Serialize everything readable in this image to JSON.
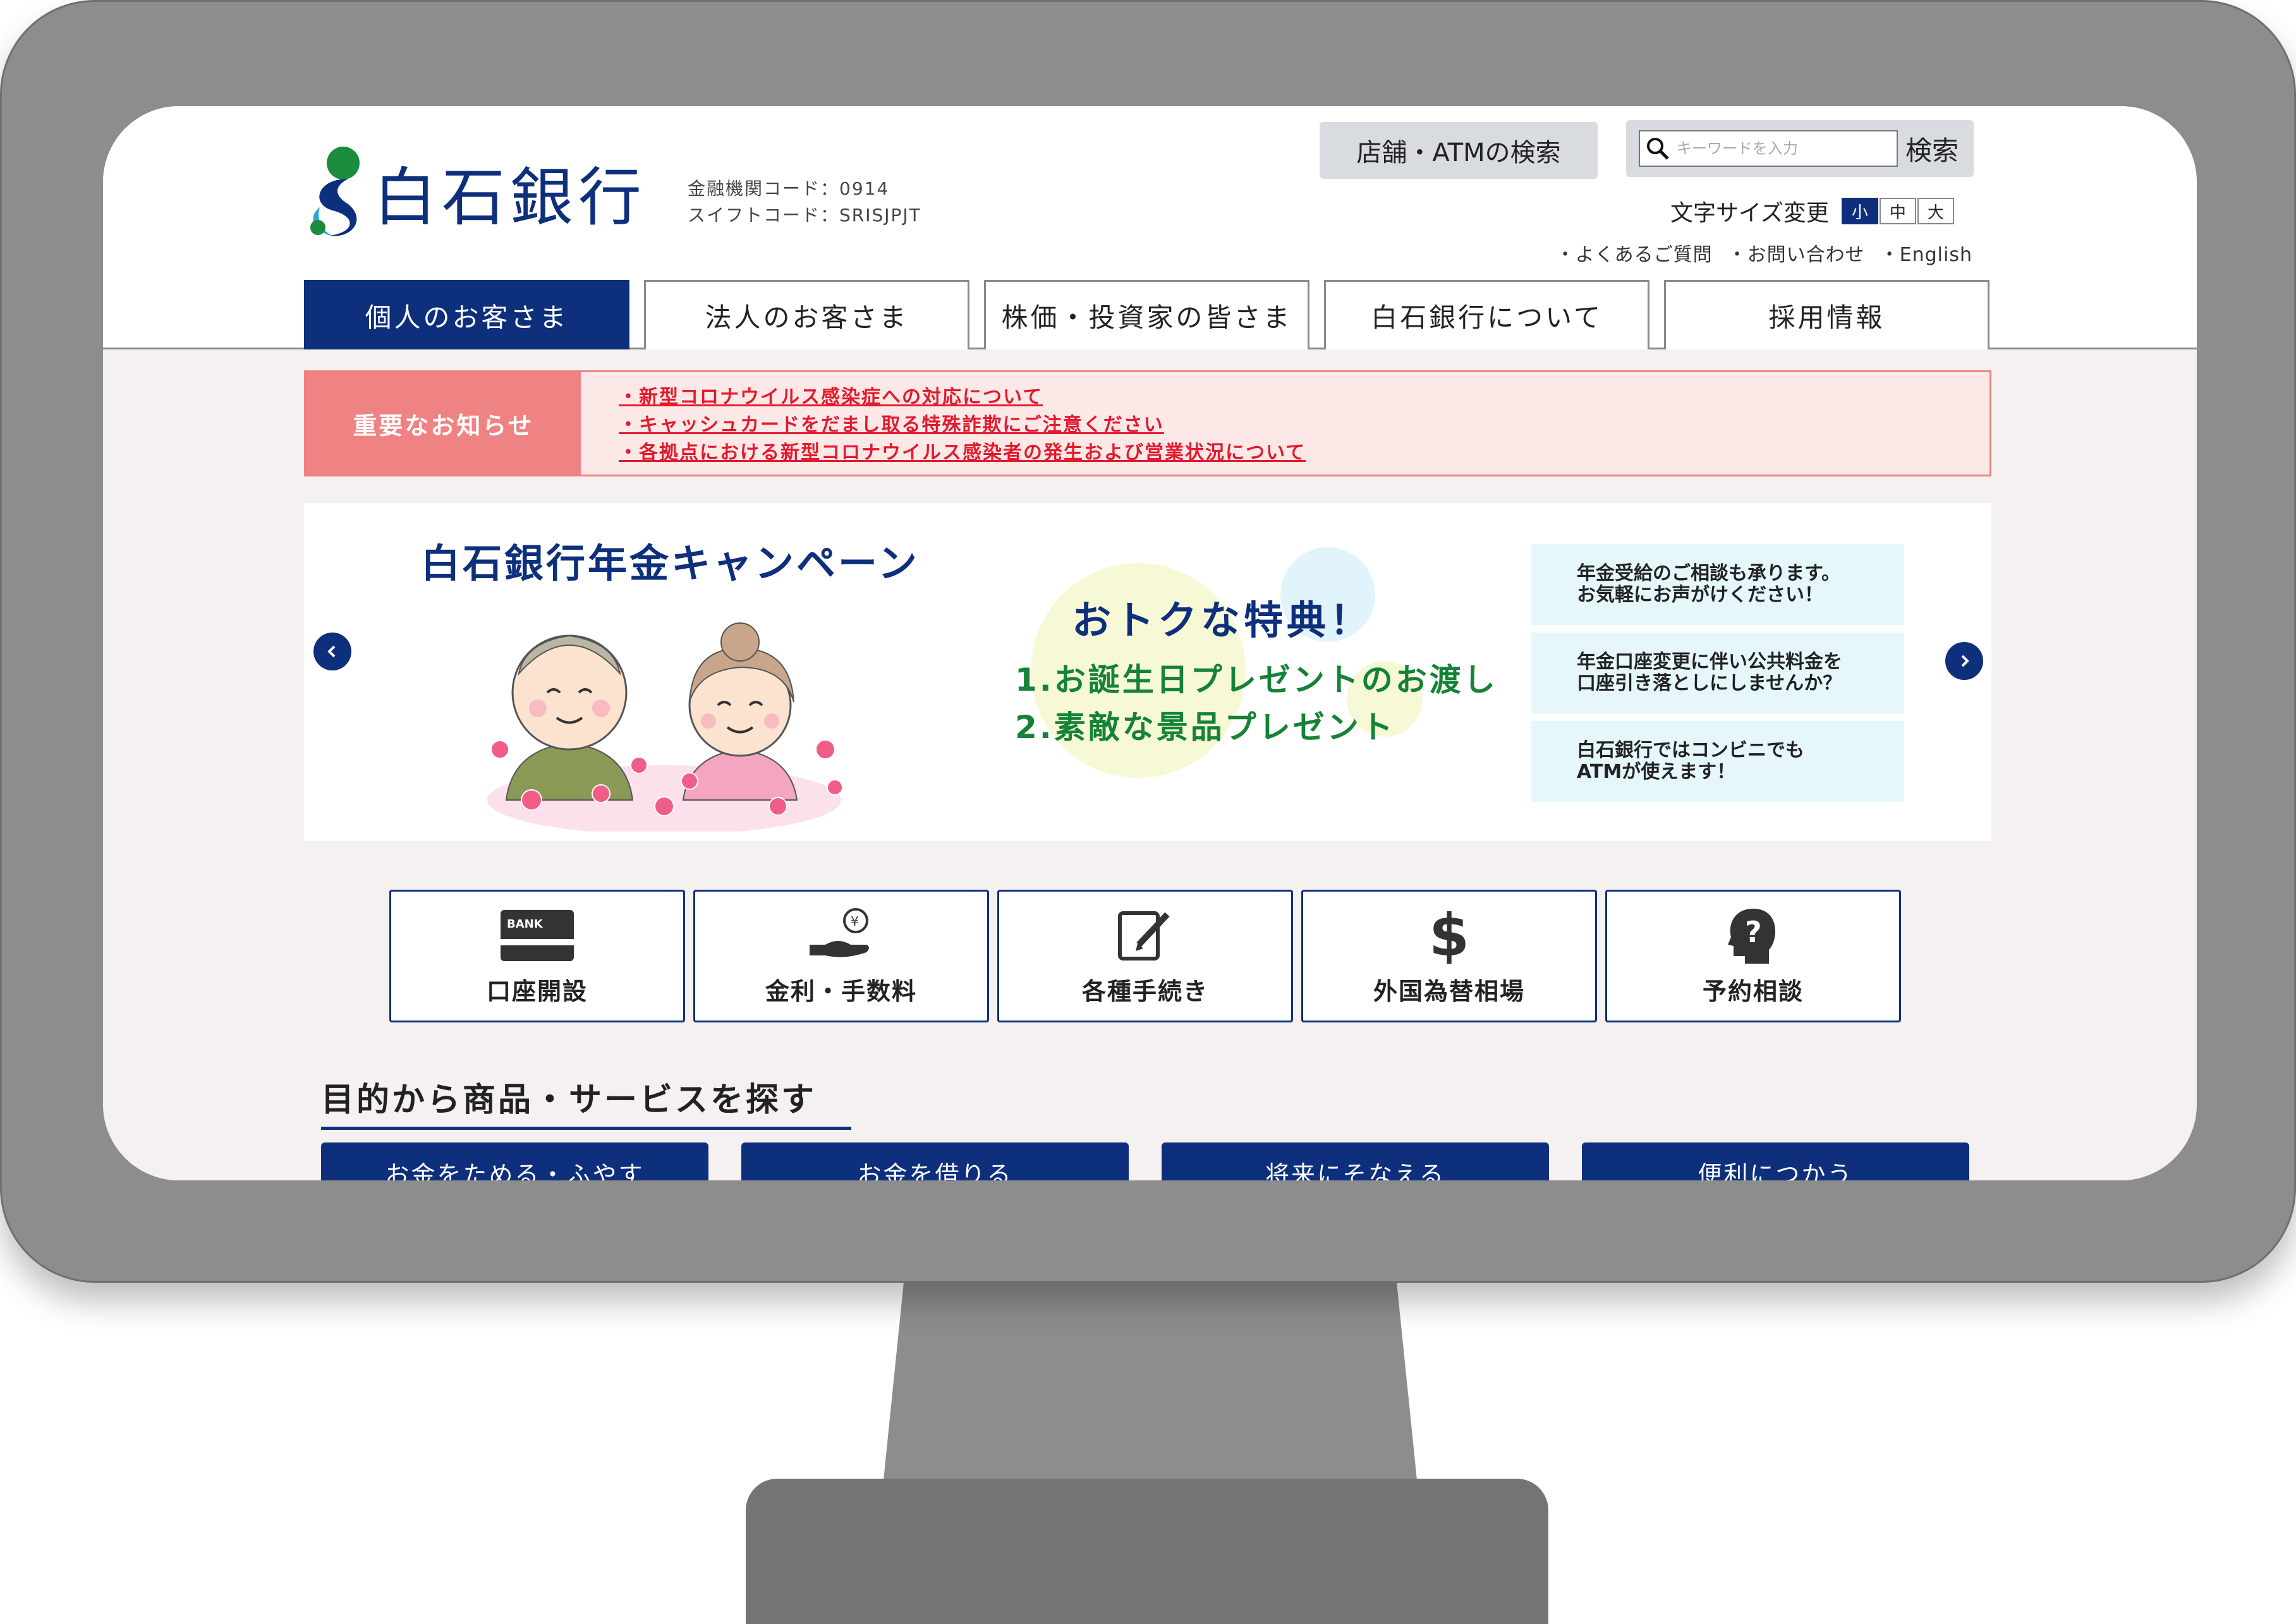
{
  "bank": {
    "name": "白石銀行",
    "code_line": "金融機関コード：0914",
    "swift_line": "スイフトコード：SRISJPJT"
  },
  "header": {
    "store_atm_search": "店舗・ATMの検索",
    "search_placeholder": "キーワードを入力",
    "search_button": "検索",
    "font_size_label": "文字サイズ変更",
    "font_sizes": [
      "小",
      "中",
      "大"
    ],
    "sub_links": [
      "・よくあるご質問",
      "・お問い合わせ",
      "・English"
    ]
  },
  "nav": {
    "tabs": [
      "個人のお客さま",
      "法人のお客さま",
      "株価・投資家の皆さま",
      "白石銀行について",
      "採用情報"
    ]
  },
  "notice": {
    "label": "重要なお知らせ",
    "links": [
      "・新型コロナウイルス感染症への対応について",
      "・キャッシュカードをだまし取る特殊詐欺にご注意ください",
      "・各拠点における新型コロナウイルス感染者の発生および営業状況について"
    ]
  },
  "banner": {
    "title": "白石銀行年金キャンペーン",
    "benefit_heading": "おトクな特典！",
    "benefit_1": "1.お誕生日プレゼントのお渡し",
    "benefit_2": "2.素敵な景品プレゼント",
    "info_1": "年金受給のご相談も承ります。\nお気軽にお声がけください！",
    "info_2": "年金口座変更に伴い公共料金を\n口座引き落としにしませんか？",
    "info_3": "白石銀行ではコンビニでも\nATMが使えます！"
  },
  "quick_links": {
    "items": [
      "口座開設",
      "金利・手数料",
      "各種手続き",
      "外国為替相場",
      "予約相談"
    ],
    "bank_card_text": "BANK",
    "yen_symbol": "¥",
    "dollar_symbol": "$",
    "question_symbol": "?"
  },
  "services": {
    "title": "目的から商品・サービスを探す",
    "categories": [
      "お金をためる・ふやす",
      "お金を借りる",
      "将来にそなえる",
      "便利につかう"
    ]
  },
  "colors": {
    "brand_navy": "#0d2f7c",
    "notice_red": "#e3192c",
    "notice_pink": "#ef8282",
    "benefit_green": "#148237"
  }
}
